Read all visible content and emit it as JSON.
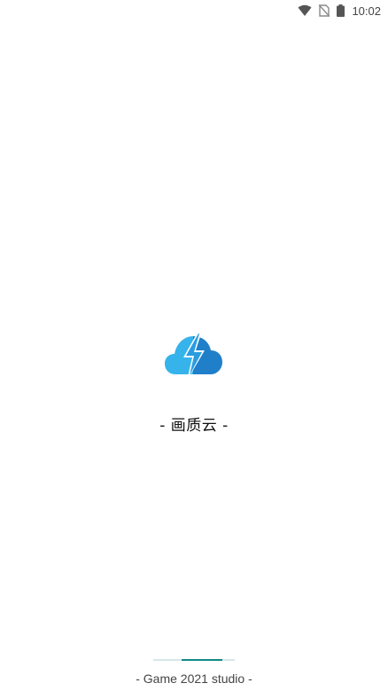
{
  "status_bar": {
    "time": "10:02",
    "icons": [
      "wifi-icon",
      "no-sim-icon",
      "battery-icon"
    ]
  },
  "splash": {
    "logo_icon": "cloud-lightning-icon",
    "app_name": "- 画质云 -",
    "colors": {
      "logo_light": "#36b3ea",
      "logo_dark": "#1f7fc9"
    }
  },
  "footer": {
    "studio": "- Game 2021 studio -",
    "loading_progress": 0.5,
    "colors": {
      "track": "#d6e8ea",
      "fill": "#0f8a86"
    }
  }
}
